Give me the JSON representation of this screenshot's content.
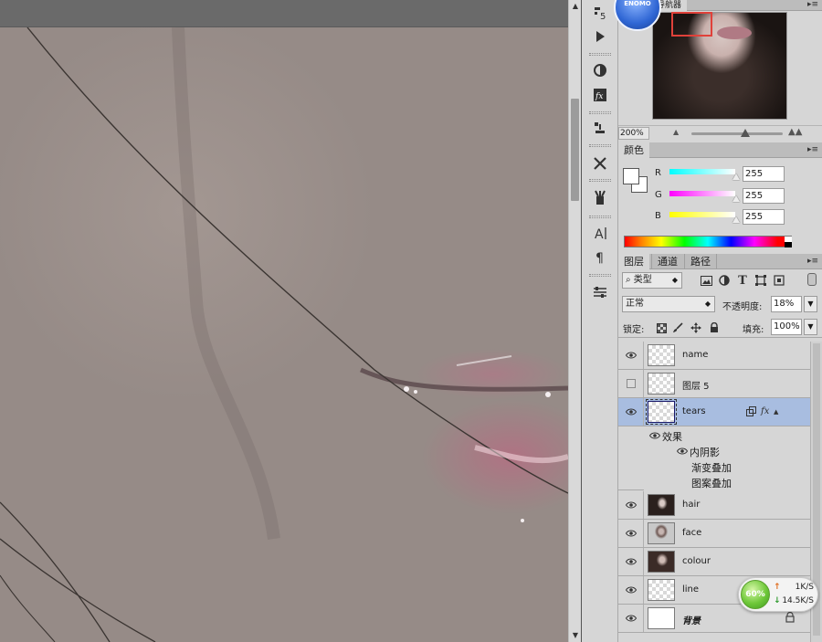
{
  "navigator": {
    "tab_label": "导航器",
    "zoom": "200%"
  },
  "color": {
    "tab_label": "颜色",
    "foreground": "#ffffff",
    "background": "#ffffff",
    "channels": [
      {
        "label": "R",
        "value": "255",
        "gradient": "#00ffff"
      },
      {
        "label": "G",
        "value": "255",
        "gradient": "#ff00ff"
      },
      {
        "label": "B",
        "value": "255",
        "gradient": "#ffff00"
      }
    ]
  },
  "layers_panel": {
    "tabs": [
      "图层",
      "通道",
      "路径"
    ],
    "kind_filter": "类型",
    "blend_mode": "正常",
    "opacity_label": "不透明度:",
    "opacity": "18%",
    "lock_label": "锁定:",
    "fill_label": "填充:",
    "fill": "100%",
    "layers": [
      {
        "name": "name",
        "visible": true,
        "thumb": "transparent"
      },
      {
        "name": "图层 5",
        "visible": false,
        "thumb": "transparent"
      },
      {
        "name": "tears",
        "visible": true,
        "thumb": "transparent",
        "selected": true,
        "fx": "fx"
      },
      {
        "name": "hair",
        "visible": true,
        "thumb": "photo-hair"
      },
      {
        "name": "face",
        "visible": true,
        "thumb": "photo-face"
      },
      {
        "name": "colour",
        "visible": true,
        "thumb": "photo-colour"
      },
      {
        "name": "line",
        "visible": true,
        "thumb": "transparent"
      },
      {
        "name": "背景",
        "visible": true,
        "thumb": "solid-white",
        "locked": true
      }
    ],
    "effects_label": "效果",
    "effects": [
      "内阴影",
      "渐变叠加",
      "图案叠加"
    ]
  },
  "network": {
    "percent": "60%",
    "upload": "1K/S",
    "download": "14.5K/S"
  },
  "badge": {
    "text": "ENOMO"
  },
  "icons": {
    "eye": "eye-icon",
    "lock": "lock-icon",
    "fx": "fx-icon"
  }
}
